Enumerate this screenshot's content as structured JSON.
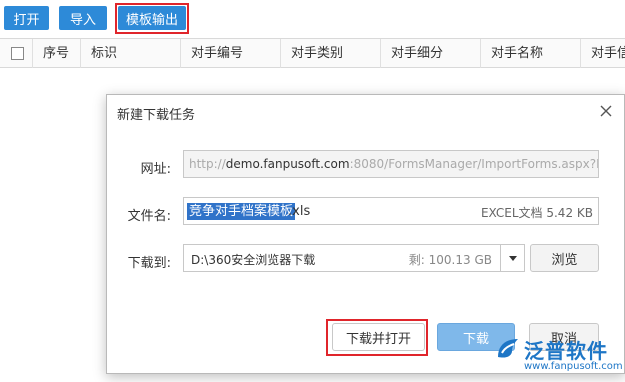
{
  "toolbar": {
    "open_label": "打开",
    "import_label": "导入",
    "template_export_label": "模板输出"
  },
  "table": {
    "columns": [
      "序号",
      "标识",
      "对手编号",
      "对手类别",
      "对手细分",
      "对手名称",
      "对手信"
    ]
  },
  "dialog": {
    "title": "新建下载任务",
    "url_label": "网址:",
    "url_prefix": "http://",
    "url_host": "demo.fanpusoft.com",
    "url_rest": ":8080/FormsManager/ImportForms.aspx?Fo",
    "filename_label": "文件名:",
    "filename_selected": "竞争对手档案模板",
    "filename_ext": ".xls",
    "file_meta": "EXCEL文档 5.42 KB",
    "download_to_label": "下载到:",
    "download_path": "D:\\360安全浏览器下载",
    "free_space": "剩: 100.13 GB",
    "browse_label": "浏览",
    "download_open_label": "下载并打开",
    "download_label": "下载",
    "cancel_label": "取消"
  },
  "watermark": {
    "brand": "泛普软件",
    "url": "www.fanpusoft.com"
  },
  "colors": {
    "toolbar_button": "#2d8ad8",
    "highlight_frame": "#e0252b",
    "selection": "#3073c9",
    "download_button": "#7fb8ea",
    "brand": "#1e76c6"
  }
}
